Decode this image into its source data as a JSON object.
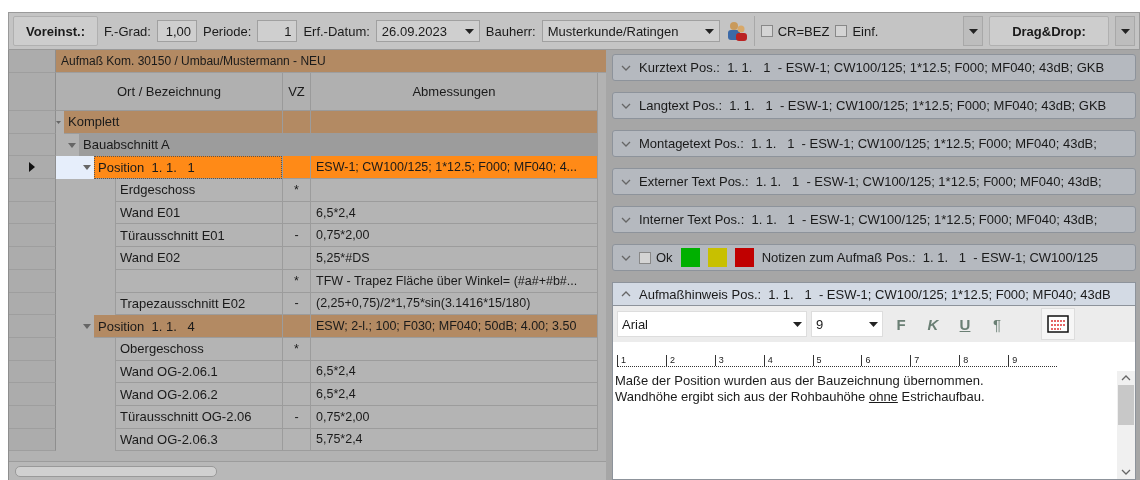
{
  "toolbar": {
    "preset_button": "Voreinst.:",
    "grade_label": "F.-Grad:",
    "grade_value": "1,00",
    "period_label": "Periode:",
    "period_value": "1",
    "date_label": "Erf.-Datum:",
    "date_value": "26.09.2023",
    "client_label": "Bauherr:",
    "client_value": "Musterkunde/Ratingen",
    "checkboxes": [
      {
        "label": "CR=BEZ",
        "checked": false
      },
      {
        "label": "Einf.",
        "checked": false
      }
    ],
    "dragdrop_button": "Drag&Drop:"
  },
  "grid": {
    "title": "Aufmaß Kom. 30150 / Umbau/Mustermann - NEU",
    "columns": [
      "Ort / Bezeichnung",
      "VZ",
      "Abmessungen"
    ],
    "rows": [
      {
        "kind": "group",
        "label": "Komplett",
        "expanded": true,
        "selected": false,
        "children": [
          {
            "kind": "section",
            "label": "Bauabschnitt A",
            "expanded": true,
            "selected": false,
            "children": [
              {
                "kind": "position",
                "label": "Position  1. 1.   1",
                "dims": "ESW-1; CW100/125; 1*12.5; F000; MF040; 4...",
                "expanded": true,
                "selected": true,
                "children": [
                  {
                    "kind": "leaf",
                    "label": "Erdgeschoss",
                    "vz": "*"
                  },
                  {
                    "kind": "leaf",
                    "label": "Wand E01",
                    "dims": "6,5*2,4"
                  },
                  {
                    "kind": "leaf",
                    "label": "Türausschnitt E01",
                    "vz": "-",
                    "dims": "0,75*2,00"
                  },
                  {
                    "kind": "leaf",
                    "label": "Wand E02",
                    "dims": "5,25*#DS"
                  },
                  {
                    "kind": "leaf",
                    "vz": "*",
                    "dims": "TFW - Trapez Fläche über Winkel= (#a#+#b#..."
                  },
                  {
                    "kind": "leaf",
                    "label": "Trapezausschnitt E02",
                    "vz": "-",
                    "dims": "(2,25+0,75)/2*1,75*sin(3.1416*15/180)"
                  }
                ]
              },
              {
                "kind": "position",
                "label": "Position  1. 1.   4",
                "dims": "ESW; 2-l.; 100; F030; MF040; 50dB; 4.00; 3.50",
                "expanded": true,
                "selected": false,
                "children": [
                  {
                    "kind": "leaf",
                    "label": "Obergeschoss",
                    "vz": "*"
                  },
                  {
                    "kind": "leaf",
                    "label": "Wand OG-2.06.1",
                    "dims": "6,5*2,4"
                  },
                  {
                    "kind": "leaf",
                    "label": "Wand OG-2.06.2",
                    "dims": "6,5*2,4"
                  },
                  {
                    "kind": "leaf",
                    "label": "Türausschnitt OG-2.06",
                    "vz": "-",
                    "dims": "0,75*2,00"
                  },
                  {
                    "kind": "leaf",
                    "label": "Wand OG-2.06.3",
                    "dims": "5,75*2,4"
                  }
                ]
              }
            ]
          }
        ]
      }
    ]
  },
  "panels": [
    {
      "kind": "plain",
      "title": "Kurztext Pos.:  1. 1.   1  - ESW-1; CW100/125; 1*12.5; F000; MF040; 43dB; GKB",
      "expanded": false
    },
    {
      "kind": "plain",
      "title": "Langtext Pos.:  1. 1.   1  - ESW-1; CW100/125; 1*12.5; F000; MF040; 43dB; GKB",
      "expanded": false
    },
    {
      "kind": "plain",
      "title": "Montagetext Pos.:  1. 1.   1  - ESW-1; CW100/125; 1*12.5; F000; MF040; 43dB;",
      "expanded": false
    },
    {
      "kind": "plain",
      "title": "Externer Text Pos.:  1. 1.   1  - ESW-1; CW100/125; 1*12.5; F000; MF040; 43dB;",
      "expanded": false
    },
    {
      "kind": "plain",
      "title": "Interner Text Pos.:  1. 1.   1  - ESW-1; CW100/125; 1*12.5; F000; MF040; 43dB;",
      "expanded": false
    },
    {
      "kind": "notes",
      "title": "Notizen zum Aufmaß Pos.:  1. 1.   1  - ESW-1; CW100/125",
      "expanded": false,
      "ok_label": "Ok",
      "ok_checked": false,
      "swatches": [
        {
          "color": "#00b000"
        },
        {
          "color": "#c8c000"
        },
        {
          "color": "#c00000"
        }
      ]
    },
    {
      "kind": "editor",
      "title": "Aufmaßhinweis Pos.:  1. 1.   1  - ESW-1; CW100/125; 1*12.5; F000; MF040; 43dB",
      "expanded": true,
      "font": "Arial",
      "size": "9",
      "format_buttons": [
        "F",
        "K",
        "U",
        "¶"
      ],
      "ruler": [
        "1",
        "2",
        "3",
        "4",
        "5",
        "6",
        "7",
        "8",
        "9"
      ],
      "lines": [
        [
          {
            "text": "Maße der Position wurden aus der Bauzeichnung übernommen.",
            "underline": false
          }
        ],
        [
          {
            "text": "Wandhöhe ergibt sich aus der Rohbauhöhe ",
            "underline": false
          },
          {
            "text": "ohne",
            "underline": true
          },
          {
            "text": " Estrichaufbau.",
            "underline": false
          }
        ]
      ]
    }
  ]
}
